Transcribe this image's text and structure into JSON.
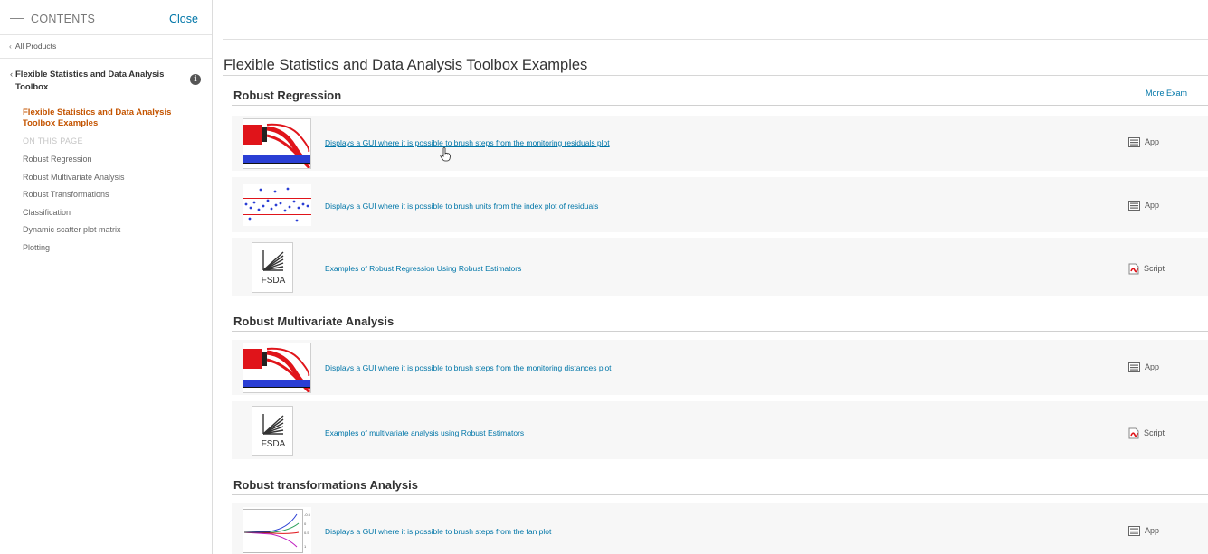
{
  "sidebar": {
    "contents_label": "CONTENTS",
    "close_label": "Close",
    "all_products": "All Products",
    "toolbox_title": "Flexible Statistics and Data Analysis Toolbox",
    "info_label": "i",
    "active_item": "Flexible Statistics and Data Analysis Toolbox Examples",
    "on_this_page": "ON THIS PAGE",
    "toc": [
      "Robust Regression",
      "Robust Multivariate Analysis",
      "Robust Transformations",
      "Classification",
      "Dynamic scatter plot matrix",
      "Plotting"
    ]
  },
  "main": {
    "title": "Flexible Statistics and Data Analysis Toolbox Examples",
    "more_examples": "More Exam",
    "sections": [
      {
        "heading": "Robust Regression",
        "items": [
          {
            "link": "Displays a GUI where it is possible to brush steps from the monitoring residuals plot",
            "type": "App"
          },
          {
            "link": "Displays a GUI where it is possible to brush units from the index plot of residuals",
            "type": "App"
          },
          {
            "link": "Examples of Robust Regression Using Robust Estimators",
            "type": "Script"
          }
        ]
      },
      {
        "heading": "Robust Multivariate Analysis",
        "items": [
          {
            "link": "Displays a GUI where it is possible to brush steps from the monitoring distances plot",
            "type": "App"
          },
          {
            "link": "Examples of multivariate analysis using Robust Estimators",
            "type": "Script"
          }
        ]
      },
      {
        "heading": "Robust transformations Analysis",
        "items": [
          {
            "link": "Displays a GUI where it is possible to brush steps from the fan plot",
            "type": "App"
          }
        ]
      }
    ],
    "fsda_logo_text": "FSDA"
  },
  "colors": {
    "link": "#0076a8",
    "active": "#c45400",
    "plot_red": "#e0141a",
    "plot_blue": "#2a3ed4"
  }
}
